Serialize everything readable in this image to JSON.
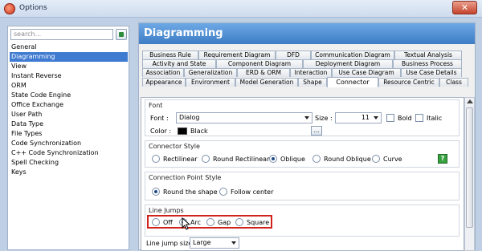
{
  "window": {
    "title": "Options",
    "close_glyph": "✕"
  },
  "left": {
    "search_placeholder": "search...",
    "items": [
      "General",
      "Diagramming",
      "View",
      "Instant Reverse",
      "ORM",
      "State Code Engine",
      "Office Exchange",
      "User Path",
      "Data Type",
      "File Types",
      "Code Synchronization",
      "C++ Code Synchronization",
      "Spell Checking",
      "Keys"
    ],
    "selected_index": 1
  },
  "header": {
    "title": "Diagramming"
  },
  "tabs": {
    "row1": [
      "Business Rule",
      "Requirement Diagram",
      "DFD",
      "Communication Diagram",
      "Textual Analysis"
    ],
    "row2": [
      "Activity and State",
      "Component Diagram",
      "Deployment Diagram",
      "Business Process"
    ],
    "row3": [
      "Association",
      "Generalization",
      "ERD & ORM",
      "Interaction",
      "Use Case Diagram",
      "Use Case Details"
    ],
    "row4": [
      "Appearance",
      "Environment",
      "Model Generation",
      "Shape",
      "Connector",
      "Resource Centric",
      "Class"
    ],
    "active": "Connector"
  },
  "font": {
    "section_title": "Font",
    "font_label": "Font :",
    "font_value": "Dialog",
    "size_label": "Size :",
    "size_value": "11",
    "bold_label": "Bold",
    "italic_label": "Italic",
    "color_label": "Color :",
    "color_value": "Black",
    "color_hex": "#000000",
    "more_label": "..."
  },
  "connector_style": {
    "section_title": "Connector Style",
    "options": [
      "Rectilinear",
      "Round Rectilinear",
      "Oblique",
      "Round Oblique",
      "Curve"
    ],
    "selected": "Oblique",
    "help_glyph": "?"
  },
  "connection_point_style": {
    "section_title": "Connection Point Style",
    "options": [
      "Round the shape",
      "Follow center"
    ],
    "selected": "Round the shape"
  },
  "line_jumps": {
    "section_title": "Line Jumps",
    "options": [
      "Off",
      "Arc",
      "Gap",
      "Square"
    ],
    "selected": "Arc",
    "size_label": "Line jump size :",
    "size_value": "Large"
  },
  "colors": {
    "accent": "#3f7bd1",
    "header": "#4a88d0",
    "highlight": "#d0211b"
  }
}
